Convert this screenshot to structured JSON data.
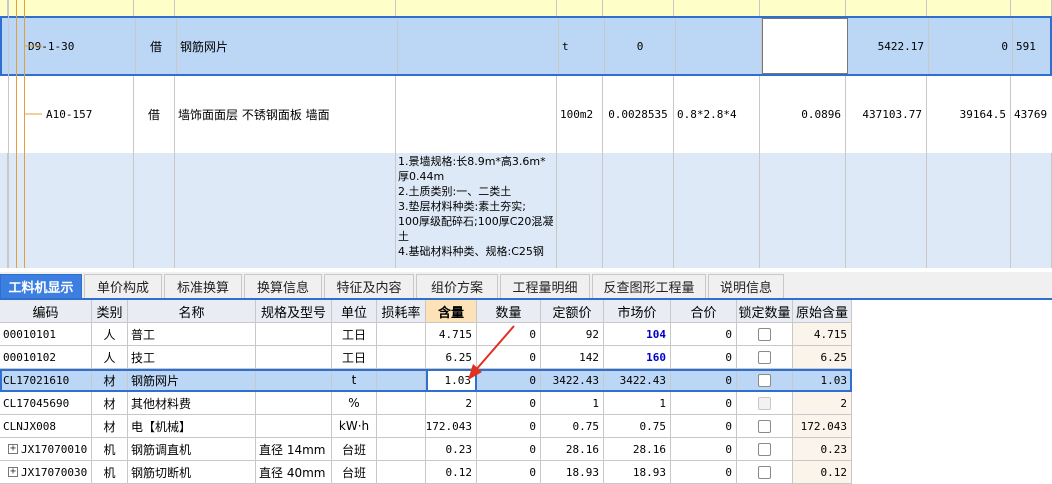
{
  "upper": {
    "row_d9": {
      "code": "D9-1-30",
      "borrow": "借",
      "name": "钢筋网片",
      "unit": "t",
      "qty": "0",
      "v1": "5422.17",
      "v2": "0",
      "v3": "591"
    },
    "row_a10": {
      "code": "A10-157",
      "borrow": "借",
      "name": "墙饰面面层 不锈钢面板 墙面",
      "unit": "100m2",
      "qty": "0.0028535",
      "spec": "0.8*2.8*4",
      "v0": "0.0896",
      "v1": "437103.77",
      "v2": "39164.5",
      "v3": "43769"
    },
    "desc_lines": [
      "1.景墙规格:长8.9m*高3.6m*",
      "厚0.44m",
      "2.土质类别:一、二类土",
      "3.垫层材料种类:素土夯实;",
      "100厚级配碎石;100厚C20混凝",
      "土",
      "4.基础材料种类、规格:C25钢"
    ]
  },
  "tabs": [
    "工料机显示",
    "单价构成",
    "标准换算",
    "换算信息",
    "特征及内容",
    "组价方案",
    "工程量明细",
    "反查图形工程量",
    "说明信息"
  ],
  "columns": [
    "编码",
    "类别",
    "名称",
    "规格及型号",
    "单位",
    "损耗率",
    "含量",
    "数量",
    "定额价",
    "市场价",
    "合价",
    "锁定数量",
    "原始含量"
  ],
  "rows": [
    {
      "code": "00010101",
      "type": "人",
      "name": "普工",
      "spec": "",
      "unit": "工日",
      "loss": "",
      "content": "4.715",
      "qty": "0",
      "quota": "92",
      "market": "104",
      "total": "0",
      "orig": "4.715"
    },
    {
      "code": "00010102",
      "type": "人",
      "name": "技工",
      "spec": "",
      "unit": "工日",
      "loss": "",
      "content": "6.25",
      "qty": "0",
      "quota": "142",
      "market": "160",
      "total": "0",
      "orig": "6.25"
    },
    {
      "code": "CL17021610",
      "type": "材",
      "name": "钢筋网片",
      "spec": "",
      "unit": "t",
      "loss": "",
      "content": "1.03",
      "qty": "0",
      "quota": "3422.43",
      "market": "3422.43",
      "total": "0",
      "orig": "1.03"
    },
    {
      "code": "CL17045690",
      "type": "材",
      "name": "其他材料费",
      "spec": "",
      "unit": "%",
      "loss": "",
      "content": "2",
      "qty": "0",
      "quota": "1",
      "market": "1",
      "total": "0",
      "orig": "2"
    },
    {
      "code": "CLNJX008",
      "type": "材",
      "name": "电【机械】",
      "spec": "",
      "unit": "kW·h",
      "loss": "",
      "content": "172.043",
      "qty": "0",
      "quota": "0.75",
      "market": "0.75",
      "total": "0",
      "orig": "172.043"
    },
    {
      "code": "JX17070010",
      "type": "机",
      "name": "钢筋调直机",
      "spec": "直径 14mm",
      "unit": "台班",
      "loss": "",
      "content": "0.23",
      "qty": "0",
      "quota": "28.16",
      "market": "28.16",
      "total": "0",
      "orig": "0.23"
    },
    {
      "code": "JX17070030",
      "type": "机",
      "name": "钢筋切断机",
      "spec": "直径 40mm",
      "unit": "台班",
      "loss": "",
      "content": "0.12",
      "qty": "0",
      "quota": "18.93",
      "market": "18.93",
      "total": "0",
      "orig": "0.12"
    }
  ],
  "colors": {
    "selected_row": "#bcd6f5",
    "accent": "#3c7fe0",
    "market_highlight": "#0000c8",
    "arrow": "#e03020"
  }
}
